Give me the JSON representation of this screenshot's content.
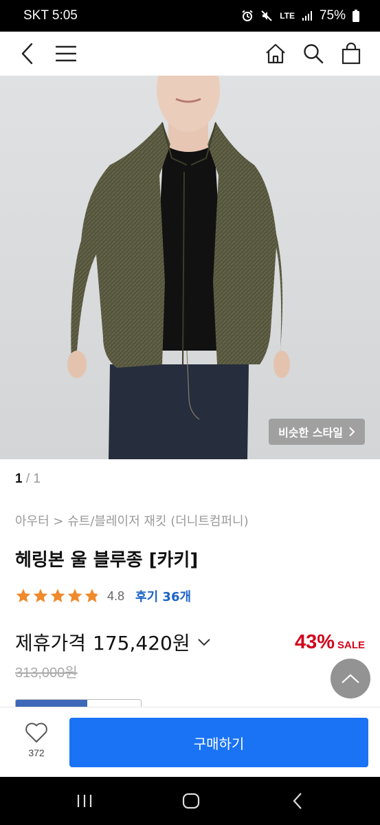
{
  "status_bar": {
    "carrier_time": "SKT 5:05",
    "network": "LTE",
    "battery": "75%"
  },
  "nav": {
    "icons": [
      "back-icon",
      "menu-icon",
      "home-icon",
      "search-icon",
      "cart-icon"
    ]
  },
  "product": {
    "similar_style_label": "비슷한 스타일",
    "pager_current": "1",
    "pager_sep": "/",
    "pager_total": "1",
    "breadcrumb": "아우터 > 슈트/블레이저 재킷 (더니트컴퍼니)",
    "title": "헤링본 울 블루종 [카키]",
    "rating": {
      "score": "4.8",
      "stars_value": 4.8,
      "review_label": "후기 36개"
    },
    "price": {
      "label": "제휴가격",
      "value": "175,420원",
      "original": "313,000원",
      "discount_pct": "43%",
      "discount_label": "SALE"
    }
  },
  "buy_bar": {
    "wish_count": "372",
    "buy_label": "구매하기"
  },
  "colors": {
    "accent_blue": "#1a73f5",
    "review_blue": "#1a63c6",
    "sale_red": "#d0021b",
    "star_orange": "#f08a2b"
  }
}
